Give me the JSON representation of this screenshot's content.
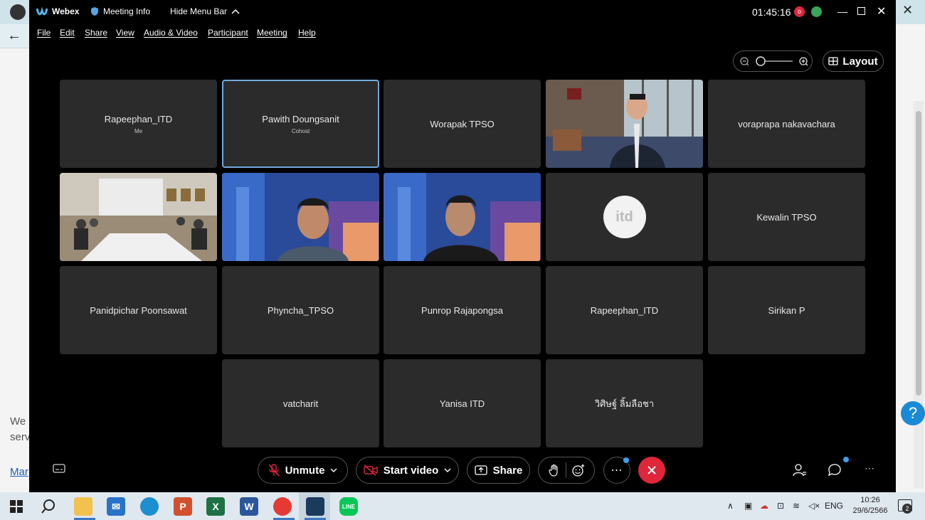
{
  "background_browser": {
    "left_text_1": "We",
    "left_text_2": "serv",
    "left_link": "Mar"
  },
  "titlebar": {
    "app_name": "Webex",
    "meeting_info": "Meeting Info",
    "hide_menu_bar": "Hide Menu Bar",
    "timer": "01:45:16",
    "record_badge": "o"
  },
  "menubar": [
    "File",
    "Edit",
    "Share",
    "View",
    "Audio & Video",
    "Participant",
    "Meeting",
    "Help"
  ],
  "layout_label": "Layout",
  "tiles": [
    {
      "name": "Rapeephan_ITD",
      "sub": "Me"
    },
    {
      "name": "Pawith Doungsanit",
      "sub": "Cohost"
    },
    {
      "name": "Worapak TPSO",
      "sub": ""
    },
    {
      "name": "",
      "sub": ""
    },
    {
      "name": "voraprapa nakavachara",
      "sub": ""
    },
    {
      "name": "",
      "sub": ""
    },
    {
      "name": "",
      "sub": ""
    },
    {
      "name": "",
      "sub": ""
    },
    {
      "name": "itd",
      "sub": ""
    },
    {
      "name": "Kewalin TPSO",
      "sub": ""
    },
    {
      "name": "Panidpichar Poonsawat",
      "sub": ""
    },
    {
      "name": "Phyncha_TPSO",
      "sub": ""
    },
    {
      "name": "Punrop Rajapongsa",
      "sub": ""
    },
    {
      "name": "Rapeephan_ITD",
      "sub": ""
    },
    {
      "name": "Sirikan P",
      "sub": ""
    },
    {
      "name": "vatcharit",
      "sub": ""
    },
    {
      "name": "Yanisa ITD",
      "sub": ""
    },
    {
      "name": "วิศิษฐ์ ลิ้มลือชา",
      "sub": ""
    }
  ],
  "controls": {
    "unmute": "Unmute",
    "start_video": "Start video",
    "share": "Share"
  },
  "taskbar": {
    "lang": "ENG",
    "time": "10:26",
    "date": "29/6/2566",
    "notifications": "2"
  },
  "colors": {
    "end_call": "#e0263b",
    "active_border": "#6fa9dd",
    "tile_bg": "#2b2b2b"
  }
}
